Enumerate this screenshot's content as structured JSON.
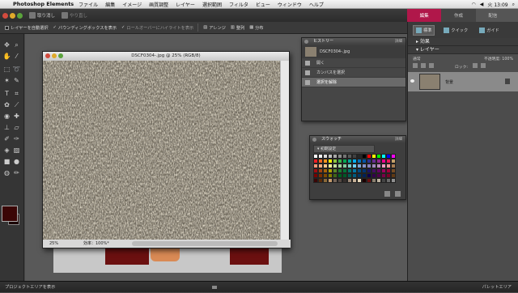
{
  "menubar": {
    "app": "Photoshop Elements",
    "items": [
      "ファイル",
      "編集",
      "イメージ",
      "画質調整",
      "レイヤー",
      "選択範囲",
      "フィルタ",
      "ビュー",
      "ウィンドウ",
      "ヘルプ"
    ],
    "clock": "火 13:09"
  },
  "appbar": {
    "undo_label": "取り消し",
    "redo_label": "やり直し"
  },
  "modetabs": {
    "edit": "編集",
    "create": "作成",
    "share": "配信"
  },
  "options": {
    "auto_select": "レイヤーを自動選択",
    "bbox": "バウンディングボックスを表示",
    "highlight": "ロールオーバーにハイライトを表示",
    "arrange": "アレンジ",
    "align": "整列",
    "distribute": "分布"
  },
  "document": {
    "title": "DSCF0304-.jpg @ 25% (RGB/8)",
    "zoom": "25%",
    "efficiency": "効率：100%*"
  },
  "history": {
    "title": "ヒストリー",
    "menu": "詳細",
    "snapshot": "DSCF0304-.jpg",
    "rows": [
      "開く",
      "カンバスを選択",
      "選択を解除"
    ]
  },
  "swatches": {
    "title": "スウォッチ",
    "menu": "詳細",
    "preset": "初期設定",
    "colors": [
      "#ffffff",
      "#f2f2f2",
      "#d9d9d9",
      "#bfbfbf",
      "#a6a6a6",
      "#8c8c8c",
      "#737373",
      "#595959",
      "#404040",
      "#262626",
      "#000000",
      "#ff0000",
      "#ffff00",
      "#00ff00",
      "#00ffff",
      "#0000ff",
      "#ff00ff",
      "#ed1c24",
      "#f26522",
      "#f7941d",
      "#fff200",
      "#8dc63f",
      "#39b54a",
      "#00a651",
      "#00a99d",
      "#00aeef",
      "#0072bc",
      "#0054a6",
      "#2e3192",
      "#662d91",
      "#92278f",
      "#ec008c",
      "#ed145b",
      "#c4a26a",
      "#f7977a",
      "#f9ad81",
      "#fdc68a",
      "#fff79a",
      "#c4df9b",
      "#a3d39c",
      "#82ca9d",
      "#7bcdc8",
      "#6ecff6",
      "#7ea7d8",
      "#8493ca",
      "#8882be",
      "#a187be",
      "#bc8dbf",
      "#f49ac2",
      "#f6989d",
      "#a67c52",
      "#9e0b0f",
      "#a0410d",
      "#a3620a",
      "#aba000",
      "#598527",
      "#1a7b30",
      "#007236",
      "#00746b",
      "#0076a3",
      "#004b80",
      "#003471",
      "#1b1464",
      "#440e62",
      "#630460",
      "#9e005d",
      "#9e0039",
      "#754c24",
      "#790000",
      "#7b2e00",
      "#7d4900",
      "#827b00",
      "#406618",
      "#005e20",
      "#005826",
      "#005952",
      "#005b7f",
      "#003663",
      "#002157",
      "#0d004c",
      "#32004b",
      "#4b0049",
      "#7b0046",
      "#7a0026",
      "#603913",
      "#3a0606",
      "#5a2b0a",
      "#8a6a3a",
      "#c69c6d",
      "#736357",
      "#534741",
      "#362f2d",
      "#998675",
      "#c7b299",
      "#e8d7b8",
      "#1b0000",
      "#6b1010",
      "#8a8070",
      "#bfb3a0",
      "#444444",
      "#6a6a6a",
      "#909090"
    ]
  },
  "rightbin": {
    "btn_standard": "標準",
    "btn_quick": "クイック",
    "btn_guide": "ガイド",
    "effects": "効果",
    "layers": "レイヤー",
    "mode": "通常",
    "opacity": "不透明度: 100%",
    "lock": "ロック:",
    "layer_name": "背景"
  },
  "bottombar": {
    "left": "プロジェクトエリアを表示",
    "right": "パレットエリア"
  }
}
